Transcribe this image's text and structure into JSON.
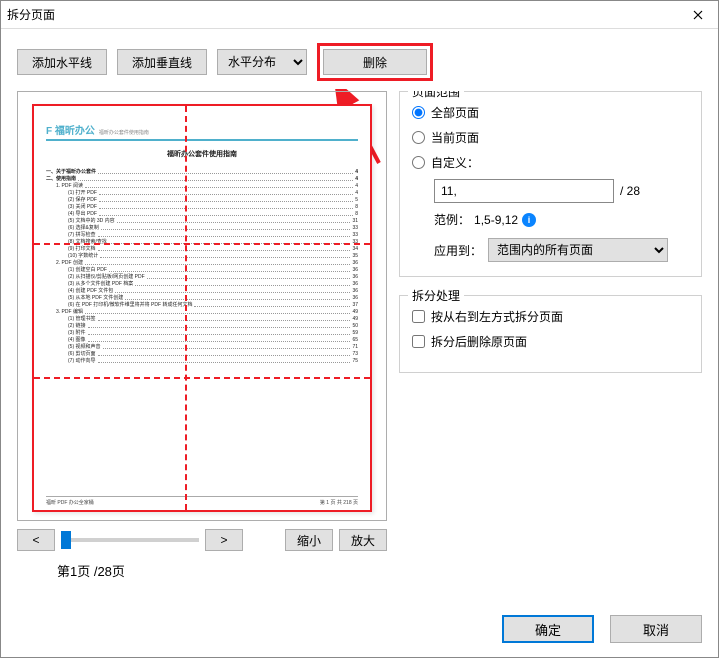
{
  "window": {
    "title": "拆分页面"
  },
  "toolbar": {
    "add_h": "添加水平线",
    "add_v": "添加垂直线",
    "distribute_select": "水平分布",
    "delete": "删除"
  },
  "preview": {
    "logo_brand": "F 福昕办公",
    "logo_sub": "福昕办公套件使用指南",
    "doc_title": "福昕办公套件使用指南",
    "toc": [
      {
        "lv": 1,
        "t": "一、关于福昕办公套件",
        "p": "4"
      },
      {
        "lv": 1,
        "t": "二、使用指南",
        "p": "4"
      },
      {
        "lv": 2,
        "t": "1. PDF 阅读",
        "p": "4"
      },
      {
        "lv": 3,
        "t": "(1) 打开 PDF",
        "p": "4"
      },
      {
        "lv": 3,
        "t": "(2) 保存 PDF",
        "p": "5"
      },
      {
        "lv": 3,
        "t": "(3) 关闭 PDF",
        "p": "8"
      },
      {
        "lv": 3,
        "t": "(4) 导出 PDF",
        "p": "8"
      },
      {
        "lv": 3,
        "t": "(5) 文档中的 3D 内容",
        "p": "31"
      },
      {
        "lv": 3,
        "t": "(6) 选择&复制",
        "p": "33"
      },
      {
        "lv": 3,
        "t": "(7) 拼写检查",
        "p": "33"
      },
      {
        "lv": 3,
        "t": "(8) 文档搜索/查找",
        "p": "33"
      },
      {
        "lv": 3,
        "t": "(9) 打印文档",
        "p": "34"
      },
      {
        "lv": 3,
        "t": "(10) 字数统计",
        "p": "35"
      },
      {
        "lv": 2,
        "t": "2. PDF 创建",
        "p": "36"
      },
      {
        "lv": 3,
        "t": "(1) 创建空白 PDF",
        "p": "36"
      },
      {
        "lv": 3,
        "t": "(2) 从扫描仪/剪贴板/网页创建 PDF",
        "p": "36"
      },
      {
        "lv": 3,
        "t": "(3) 从多个文件创建 PDF 档案",
        "p": "36"
      },
      {
        "lv": 3,
        "t": "(4) 创建 PDF 文件包",
        "p": "36"
      },
      {
        "lv": 3,
        "t": "(5) 从本地 PDF 文件创建",
        "p": "36"
      },
      {
        "lv": 3,
        "t": "(6) 在 PDF 打印机/微软件维里将并将 PDF 转成任何文档",
        "p": "37"
      },
      {
        "lv": 2,
        "t": "3. PDF 编辑",
        "p": "49"
      },
      {
        "lv": 3,
        "t": "(1) 管理书签",
        "p": "49"
      },
      {
        "lv": 3,
        "t": "(2) 链接",
        "p": "50"
      },
      {
        "lv": 3,
        "t": "(3) 附件",
        "p": "59"
      },
      {
        "lv": 3,
        "t": "(4) 图像",
        "p": "65"
      },
      {
        "lv": 3,
        "t": "(5) 视频和声音",
        "p": "71"
      },
      {
        "lv": 3,
        "t": "(6) 剪切页面",
        "p": "73"
      },
      {
        "lv": 3,
        "t": "(7) 动作向导",
        "p": "75"
      }
    ],
    "footer_left": "福昕 PDF 办公全家桶",
    "footer_right": "第 1 页 共 218 页",
    "nav_prev": "<",
    "nav_next": ">",
    "zoom_out": "缩小",
    "zoom_in": "放大",
    "page_indicator": "第1页 /28页"
  },
  "page_range": {
    "group_title": "页面范围",
    "opt_all": "全部页面",
    "opt_current": "当前页面",
    "opt_custom": "自定义：",
    "custom_value": "11,",
    "total_suffix": "/ 28",
    "hint_label": "范例：",
    "hint_value": "1,5-9,12",
    "apply_label": "应用到：",
    "apply_value": "范围内的所有页面"
  },
  "split_handle": {
    "group_title": "拆分处理",
    "chk_rtl": "按从右到左方式拆分页面",
    "chk_del": "拆分后删除原页面"
  },
  "footer": {
    "ok": "确定",
    "cancel": "取消"
  }
}
